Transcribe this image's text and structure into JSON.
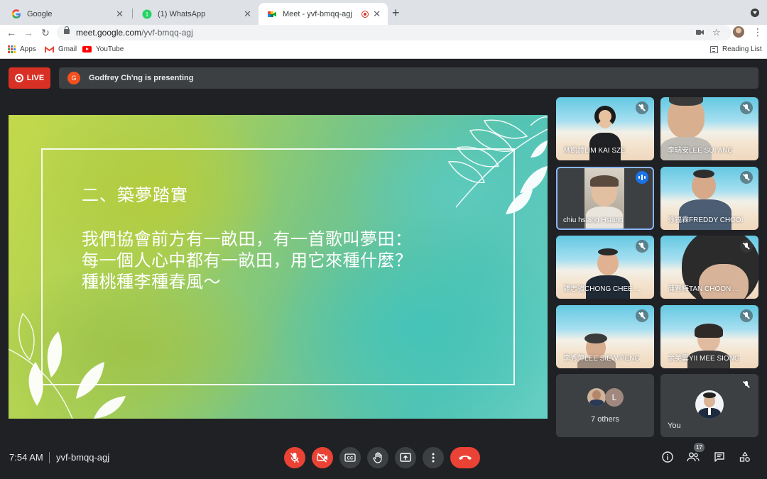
{
  "browser": {
    "tabs": [
      {
        "title": "Google",
        "icon": "google-icon"
      },
      {
        "title": "(1) WhatsApp",
        "icon": "whatsapp-icon"
      },
      {
        "title": "Meet - yvf-bmqq-agj",
        "icon": "meet-icon",
        "active": true
      }
    ],
    "url_host": "meet.google.com",
    "url_path": "/yvf-bmqq-agj",
    "bookmarks": [
      {
        "label": "Apps",
        "icon": "apps-icon"
      },
      {
        "label": "Gmail",
        "icon": "gmail-icon"
      },
      {
        "label": "YouTube",
        "icon": "youtube-icon"
      }
    ],
    "reading_list": "Reading List"
  },
  "meet": {
    "live_label": "LIVE",
    "presenter_initial": "G",
    "presenting_text": "Godfrey Ch'ng is presenting",
    "slide": {
      "heading": "二、築夢踏實",
      "lines": [
        "我們協會前方有一畝田，有一首歌叫夢田：",
        "每一個人心中都有一畝田，用它來種什麼？",
        "種桃種李種春風～"
      ]
    },
    "participants": [
      {
        "name": "林凱詩LIM KAI SZE",
        "mic": "muted"
      },
      {
        "name": "李瑞安LEE SUI ANG",
        "mic": "muted"
      },
      {
        "name": "chiu hsiang Hsiang",
        "mic": "speaking"
      },
      {
        "name": "徐福霖FREDDY CHOOI",
        "mic": "muted"
      },
      {
        "name": "鍾志強CHONG CHEE ...",
        "mic": "muted"
      },
      {
        "name": "陳春梅TAN CHOON ...",
        "mic": "muted"
      },
      {
        "name": "李秀萍LEE SIEW PENG",
        "mic": "muted"
      },
      {
        "name": "余美雲YII MEE SIONG",
        "mic": "muted"
      }
    ],
    "others_initial": "L",
    "others_label": "7 others",
    "you_label": "You",
    "time": "7:54 AM",
    "meeting_code": "yvf-bmqq-agj",
    "people_count": "17",
    "colors": {
      "live": "#d93025",
      "danger": "#ea4335",
      "speaking": "#1a73e8",
      "bg": "#202124",
      "tile": "#3c4043"
    }
  }
}
